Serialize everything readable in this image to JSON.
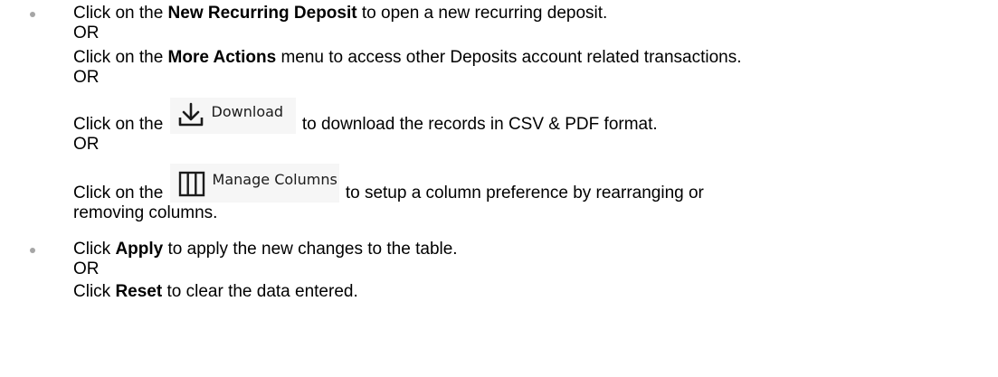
{
  "items": [
    {
      "new_deposit_prefix": "Click on the ",
      "new_deposit_bold": "New Recurring Deposit",
      "new_deposit_suffix": " to open a new recurring deposit.",
      "or_1": "OR",
      "more_actions_prefix": "Click on the ",
      "more_actions_bold": "More Actions",
      "more_actions_suffix": " menu to access other Deposits account related transactions.",
      "or_2": "OR",
      "download_prefix": "Click on the ",
      "download_button_label": "Download",
      "download_button_icon": "download-icon",
      "download_suffix": " to download the records in CSV & PDF format.",
      "or_3": "OR",
      "columns_prefix": "Click on the ",
      "columns_button_label": "Manage Columns",
      "columns_button_icon": "columns-icon",
      "columns_suffix": " to setup a column preference by rearranging or",
      "columns_suffix_2": "removing columns."
    },
    {
      "apply_prefix": "Click ",
      "apply_bold": "Apply",
      "apply_suffix": " to apply the new changes to the table.",
      "or_4": "OR",
      "reset_prefix": "Click ",
      "reset_bold": "Reset",
      "reset_suffix": " to clear the data entered."
    }
  ],
  "colors": {
    "text": "#000000",
    "bullet": "#a6a6a6",
    "button_background": "#f6f6f6",
    "icon": "#1b1b1b"
  }
}
